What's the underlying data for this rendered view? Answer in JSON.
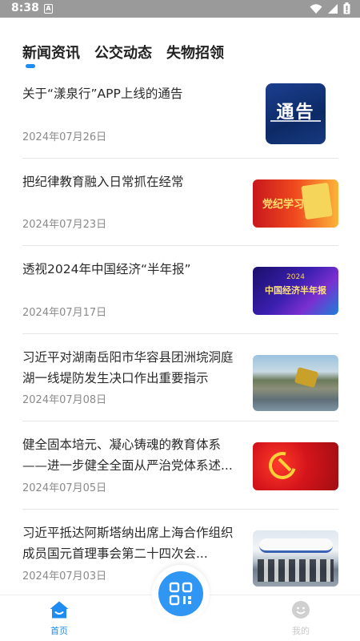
{
  "status_bar": {
    "time": "8:38",
    "notification_glyph": "A"
  },
  "tabs": [
    {
      "label": "新闻资讯",
      "active": true
    },
    {
      "label": "公交动态",
      "active": false
    },
    {
      "label": "失物招领",
      "active": false
    }
  ],
  "news": [
    {
      "title": "关于“漾泉行”APP上线的通告",
      "date": "2024年07月26日",
      "thumb_text": "通告"
    },
    {
      "title": "把纪律教育融入日常抓在经常",
      "date": "2024年07月23日",
      "thumb_text": "党纪学习教育"
    },
    {
      "title": "透视2024年中国经济“半年报”",
      "date": "2024年07月17日",
      "thumb_text": "中国经济半年报",
      "thumb_year": "2024"
    },
    {
      "title": "习近平对湖南岳阳市华容县团洲垸洞庭湖一线堤防发生决口作出重要指示",
      "date": "2024年07月08日"
    },
    {
      "title": "健全固本培元、凝心铸魂的教育体系——进一步健全全面从严治党体系述...",
      "date": "2024年07月05日"
    },
    {
      "title": "习近平抵达阿斯塔纳出席上海合作组织成员国元首理事会第二十四次会...",
      "date": "2024年07月03日"
    }
  ],
  "bottom_nav": {
    "home_label": "首页",
    "mine_label": "我的"
  },
  "colors": {
    "accent": "#1e8cf0",
    "status_bar": "#9a9a9a"
  }
}
